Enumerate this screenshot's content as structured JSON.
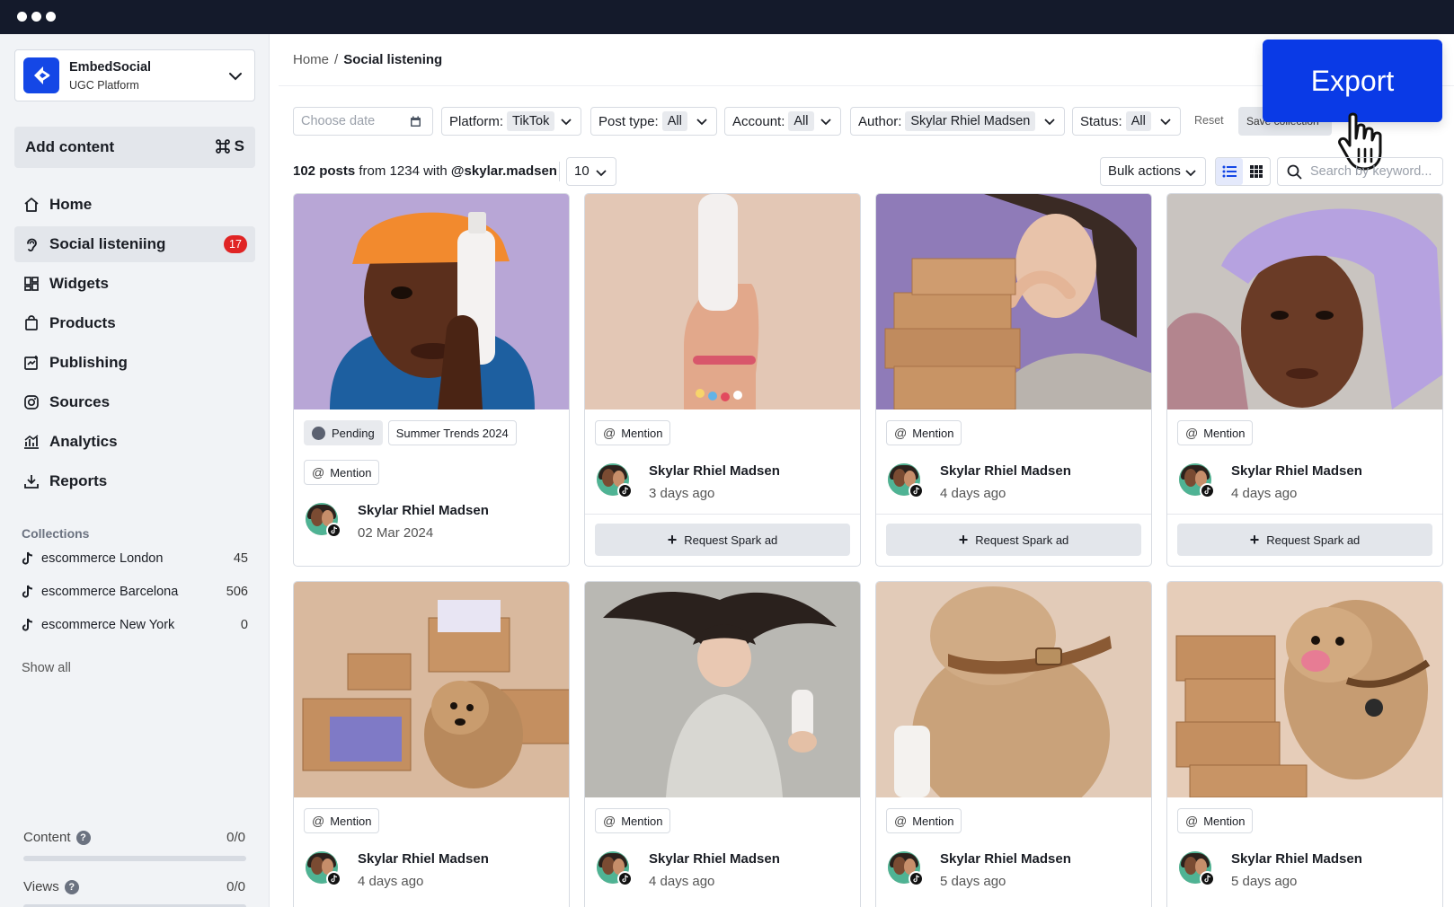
{
  "app": {
    "workspace_name": "EmbedSocial",
    "workspace_subtitle": "UGC Platform",
    "brand_color": "#1447e6"
  },
  "sidebar": {
    "add_content_label": "Add content",
    "add_content_shortcut": "S",
    "items": [
      {
        "label": "Home",
        "icon": "home-icon",
        "active": false
      },
      {
        "label": "Social listeniing",
        "icon": "ear-icon",
        "active": true,
        "badge": "17"
      },
      {
        "label": "Widgets",
        "icon": "widgets-icon",
        "active": false
      },
      {
        "label": "Products",
        "icon": "shopping-bag-icon",
        "active": false
      },
      {
        "label": "Publishing",
        "icon": "calendar-icon",
        "active": false
      },
      {
        "label": "Sources",
        "icon": "instagram-icon",
        "active": false
      },
      {
        "label": "Analytics",
        "icon": "chart-icon",
        "active": false
      },
      {
        "label": "Reports",
        "icon": "download-icon",
        "active": false
      }
    ],
    "collections_title": "Collections",
    "collections": [
      {
        "label": "escommerce London",
        "count": "45"
      },
      {
        "label": "escommerce Barcelona",
        "count": "506"
      },
      {
        "label": "escommerce New York",
        "count": "0"
      }
    ],
    "show_all": "Show all",
    "usage": [
      {
        "label": "Content",
        "value": "0/0",
        "fraction": 0
      },
      {
        "label": "Views",
        "value": "0/0",
        "fraction": 0
      }
    ]
  },
  "breadcrumb": {
    "home": "Home",
    "separator": "/",
    "current": "Social listening"
  },
  "filters": {
    "date_placeholder": "Choose date",
    "platform_label": "Platform:",
    "platform_value": "TikTok",
    "post_type_label": "Post type:",
    "post_type_value": "All",
    "account_label": "Account:",
    "account_value": "All",
    "author_label": "Author:",
    "author_value": "Skylar Rhiel Madsen",
    "status_label": "Status:",
    "status_value": "All",
    "reset": "Reset",
    "save_collection": "Save collection"
  },
  "export_label": "Export",
  "summary": {
    "count": "102 posts",
    "middle": " from 1234 with ",
    "handle": "@skylar.madsen",
    "per_page": "10",
    "bulk_actions": "Bulk actions",
    "search_placeholder": "Search by keyword..."
  },
  "posts": [
    {
      "status": "Pending",
      "collection": "Summer Trends 2024",
      "tag": "Mention",
      "author": "Skylar Rhiel Madsen",
      "time": "02 Mar 2024",
      "image": "man-orange-bandana-holding-curology-bottle"
    },
    {
      "tag": "Mention",
      "author": "Skylar Rhiel Madsen",
      "time": "3 days ago",
      "action": "Request Spark ad",
      "image": "hand-holding-curology-bottle"
    },
    {
      "tag": "Mention",
      "author": "Skylar Rhiel Madsen",
      "time": "4 days ago",
      "action": "Request Spark ad",
      "image": "woman-with-stacked-boxes"
    },
    {
      "tag": "Mention",
      "author": "Skylar Rhiel Madsen",
      "time": "4 days ago",
      "action": "Request Spark ad",
      "image": "woman-in-curology-towel"
    },
    {
      "tag": "Mention",
      "author": "Skylar Rhiel Madsen",
      "time": "4 days ago",
      "image": "dog-with-open-boxes"
    },
    {
      "tag": "Mention",
      "author": "Skylar Rhiel Madsen",
      "time": "4 days ago",
      "image": "woman-hair-flip-holding-bottle"
    },
    {
      "tag": "Mention",
      "author": "Skylar Rhiel Madsen",
      "time": "5 days ago",
      "image": "dog-with-collar"
    },
    {
      "tag": "Mention",
      "author": "Skylar Rhiel Madsen",
      "time": "5 days ago",
      "image": "dog-licking-by-boxes"
    }
  ]
}
